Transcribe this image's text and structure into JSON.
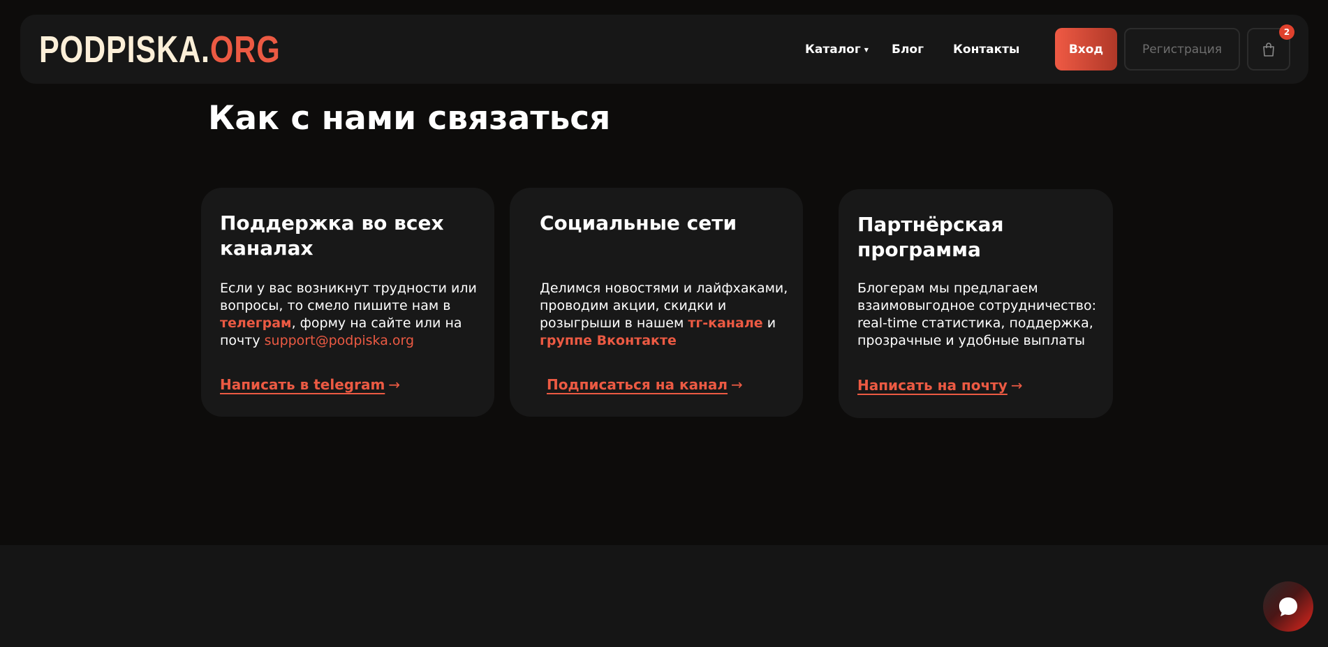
{
  "header": {
    "logo_part1": "PODPISKA.",
    "logo_part2": "ORG",
    "nav": {
      "catalog": "Каталог",
      "blog": "Блог",
      "contacts": "Контакты"
    },
    "login_label": "Вход",
    "register_label": "Регистрация",
    "cart_count": "2"
  },
  "main": {
    "title": "Как с нами связаться",
    "cards": [
      {
        "title": "Поддержка во всех каналах",
        "text_1": "Если у вас возникнут трудности или вопросы, то смело пишите нам в ",
        "highlight_1": "телеграм",
        "text_2": ", форму на сайте или на почту ",
        "email": "support@podpiska.org",
        "link": "Написать в telegram",
        "arrow": "→"
      },
      {
        "title": "Социальные сети",
        "text_1": "Делимся новостями и лайфхаками, проводим акции, скидки и розыгрыши в нашем ",
        "highlight_1": "тг-канале",
        "text_2": " и ",
        "highlight_2": "группе Вконтакте",
        "link": "Подписаться на канал",
        "arrow": "→"
      },
      {
        "title": "Партнёрская программа",
        "text_1": "Блогерам мы предлагаем взаимовыгодное сотрудничество: real-time статистика, поддержка, прозрачные и удобные выплаты",
        "link": "Написать на почту",
        "arrow": "→"
      }
    ]
  },
  "colors": {
    "accent": "#ec5a43",
    "background": "#0d0c0b",
    "card": "#181818"
  },
  "icons": {
    "cart": "shopping-bag-icon",
    "chat": "chat-bubble-icon",
    "caret": "caret-down-icon"
  }
}
